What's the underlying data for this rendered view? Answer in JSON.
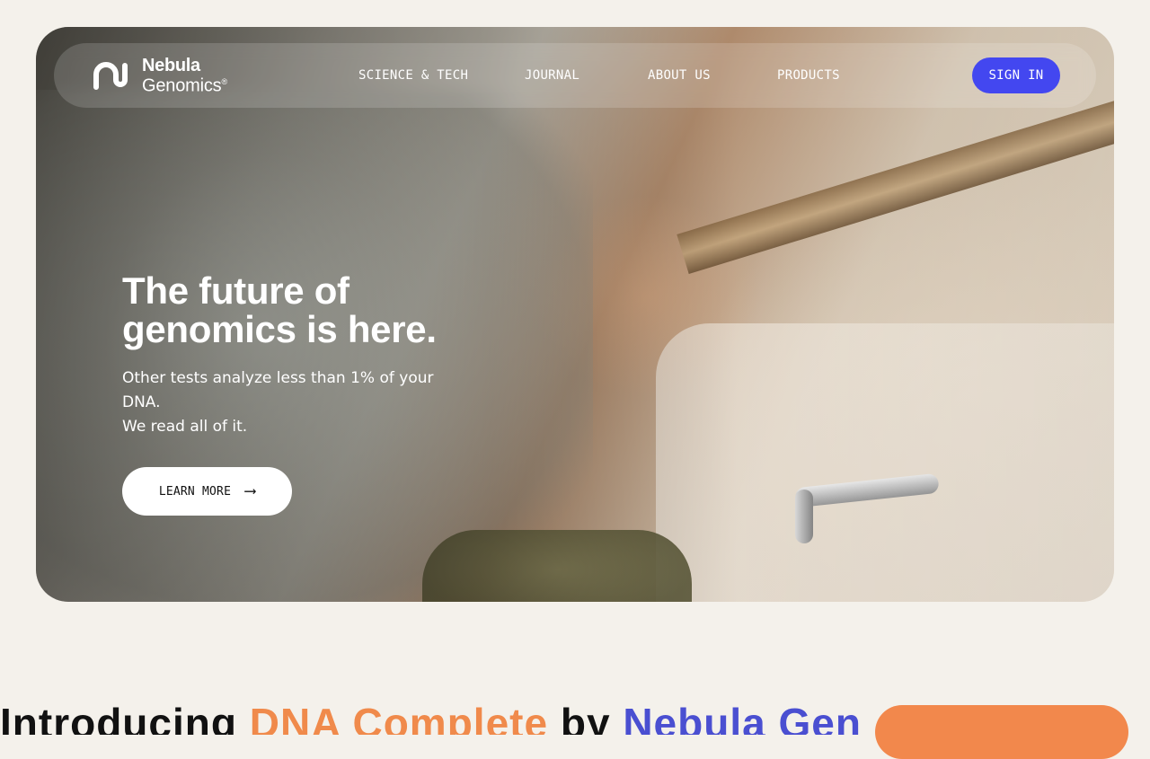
{
  "brand": {
    "name_line1": "Nebula",
    "name_line2": "Genomics",
    "registered": "®"
  },
  "nav": {
    "links": [
      {
        "label": "SCIENCE & TECH"
      },
      {
        "label": "JOURNAL"
      },
      {
        "label": "ABOUT US"
      },
      {
        "label": "PRODUCTS"
      }
    ],
    "signin_label": "SIGN IN"
  },
  "hero": {
    "headline": "The future of genomics is here.",
    "subtext_line1": "Other tests analyze less than 1% of your DNA.",
    "subtext_line2": "We read all of it.",
    "cta_label": "LEARN MORE",
    "cta_icon": "long-arrow-right-icon"
  },
  "intro": {
    "word1": "Introducing ",
    "word2": "DNA Complete",
    "word3": " by ",
    "word4": "Nebula Genomics"
  },
  "colors": {
    "background": "#f4f1eb",
    "signin_bg": "#4347f0",
    "accent_orange": "#f08a4b",
    "accent_blue": "#4a4fd1"
  }
}
